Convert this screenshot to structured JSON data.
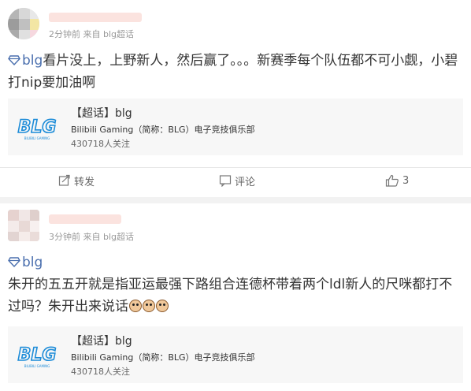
{
  "colors": {
    "topic_link": "#4a6fae",
    "logo_blue": "#1d8cd8",
    "text": "#333333",
    "meta": "#999999"
  },
  "posts": [
    {
      "meta": "2分钟前 来自 blg超话",
      "topic": "blg",
      "body": "看片没上，上野新人，然后赢了。。。新赛季每个队伍都不可小觑，小碧打nip要加油啊",
      "card": {
        "title": "【超话】blg",
        "description": "Bilibili Gaming（简称：BLG）电子竞技俱乐部",
        "followers": "430718人关注",
        "logo_icon": "blg-logo",
        "logo_text": "BLG",
        "logo_subtext": "BILIBILI GAMING"
      },
      "actions": {
        "repost": "转发",
        "comment": "评论",
        "like_count": "3"
      }
    },
    {
      "meta": "3分钟前 来自 blg超话",
      "topic": "blg",
      "body": "朱开的五五开就是指亚运最强下路组合连德杯带着两个ldl新人的尺咪都打不过吗？朱开出来说话",
      "card": {
        "title": "【超话】blg",
        "description": "Bilibili Gaming（简称：BLG）电子竞技俱乐部",
        "followers": "430718人关注",
        "logo_icon": "blg-logo",
        "logo_text": "BLG",
        "logo_subtext": "BILIBILI GAMING"
      }
    }
  ]
}
